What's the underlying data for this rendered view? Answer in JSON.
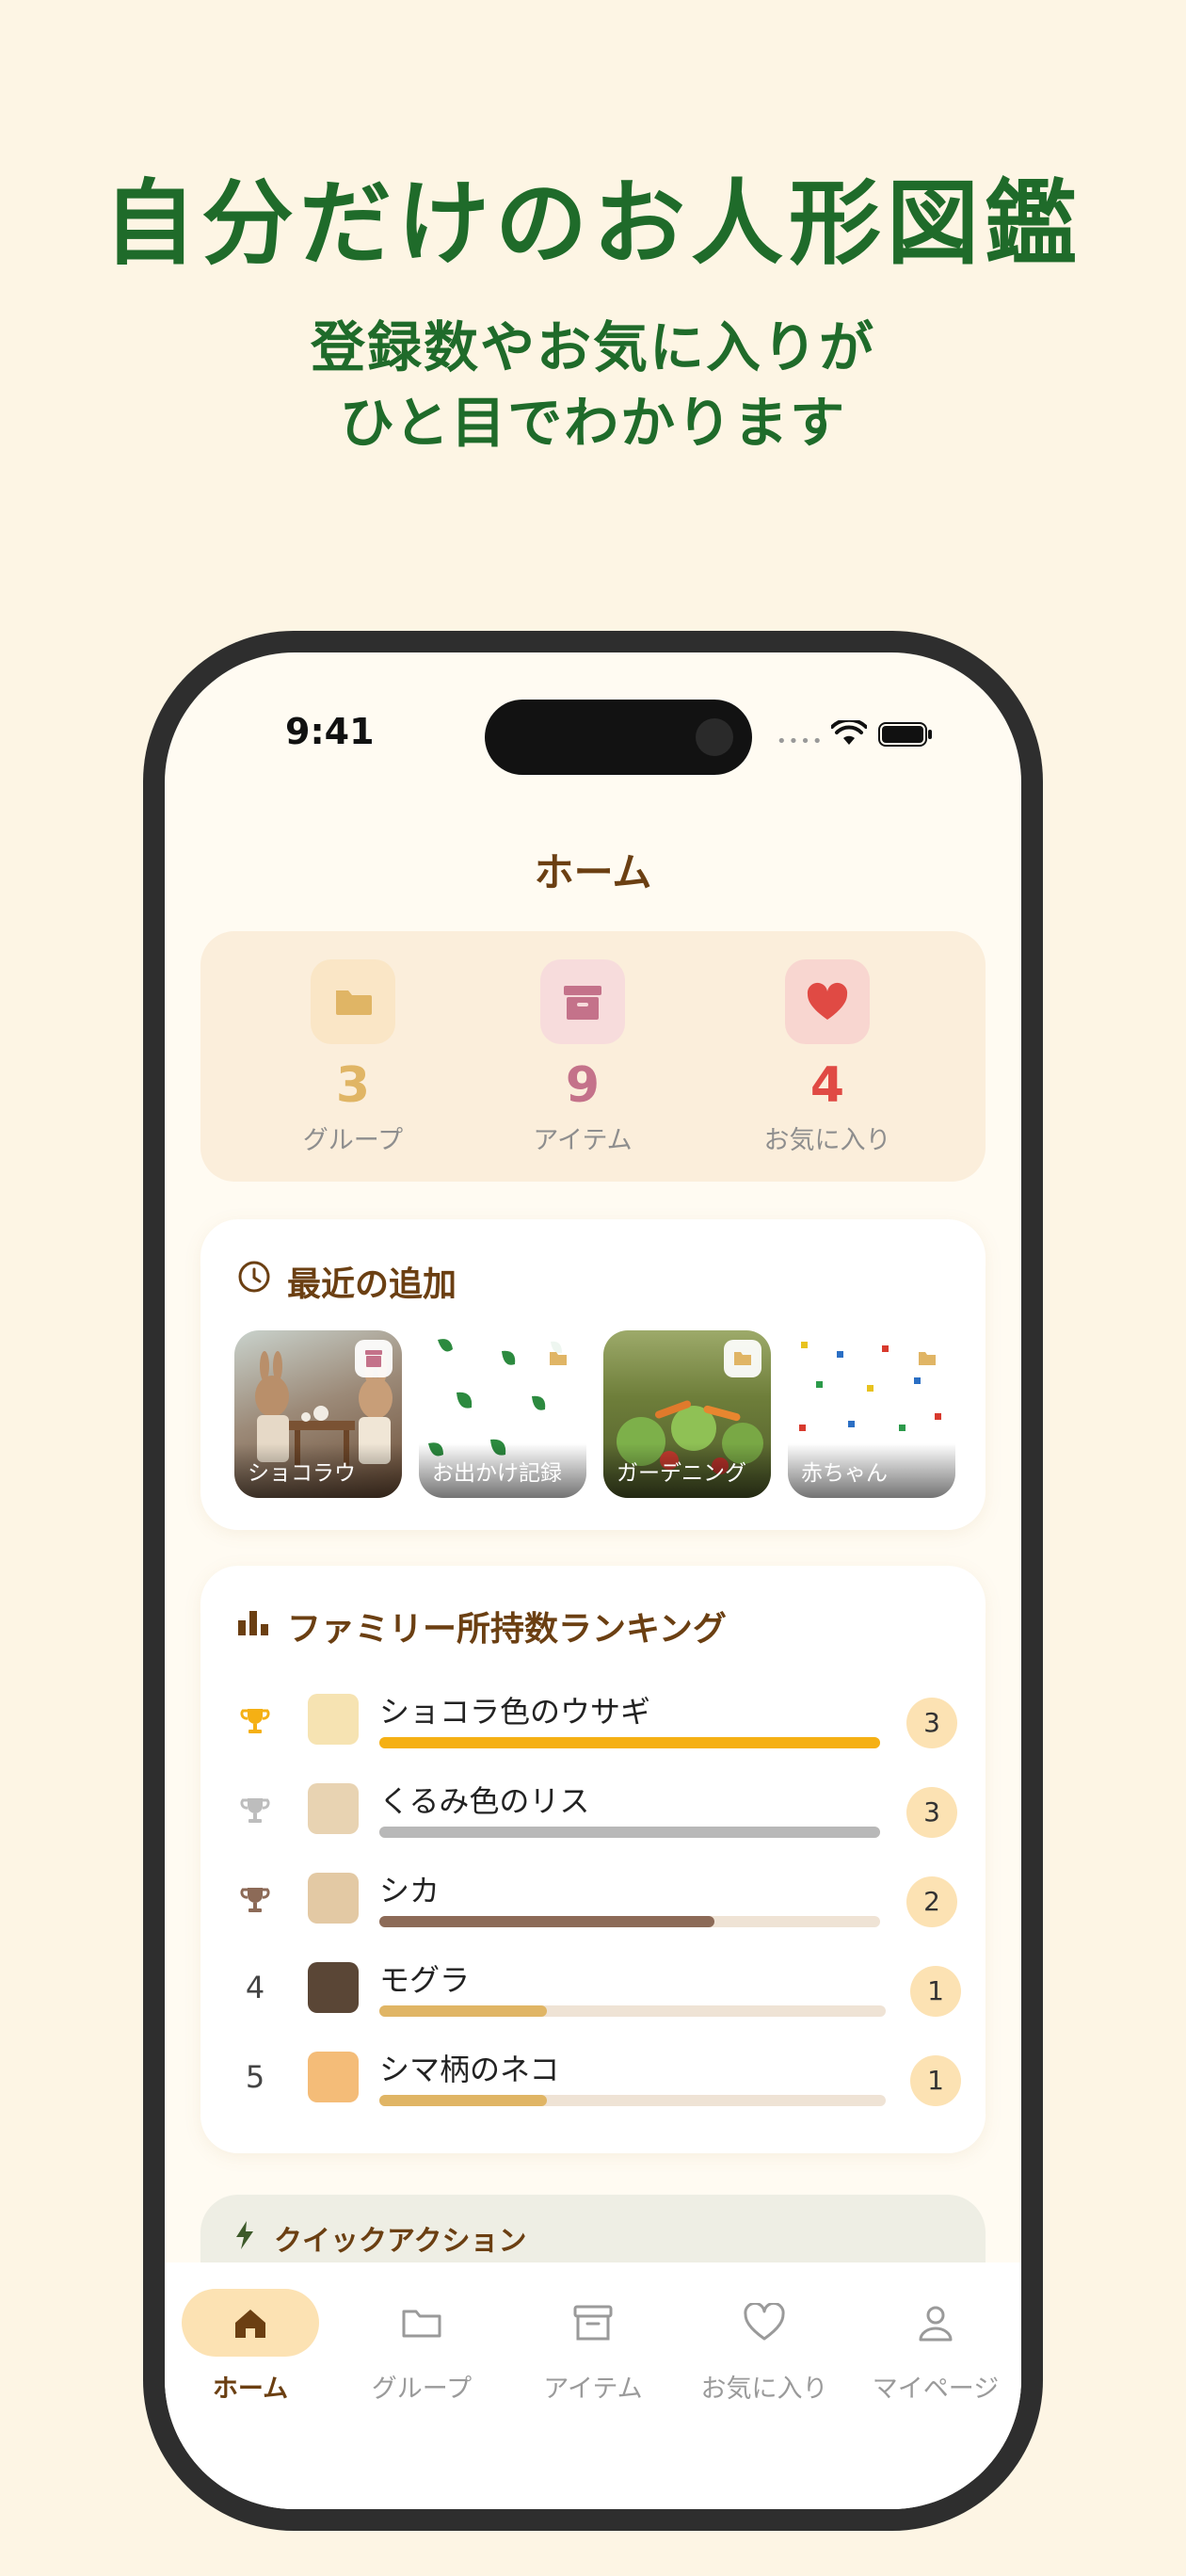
{
  "promo": {
    "headline": "自分だけのお人形図鑑",
    "subline1": "登録数やお気に入りが",
    "subline2": "ひと目でわかります"
  },
  "status_bar": {
    "time": "9:41"
  },
  "nav": {
    "title": "ホーム"
  },
  "stats": [
    {
      "value": "3",
      "label": "グループ",
      "icon": "folder-icon",
      "color": "#E0B565"
    },
    {
      "value": "9",
      "label": "アイテム",
      "icon": "archive-box-icon",
      "color": "#C4728A"
    },
    {
      "value": "4",
      "label": "お気に入り",
      "icon": "heart-icon",
      "color": "#E04A44"
    }
  ],
  "recent": {
    "title": "最近の追加",
    "items": [
      {
        "label": "ショコラウ",
        "type_icon": "archive-box-icon"
      },
      {
        "label": "お出かけ記録",
        "type_icon": "folder-icon"
      },
      {
        "label": "ガーデニング",
        "type_icon": "folder-icon"
      },
      {
        "label": "赤ちゃん",
        "type_icon": "folder-icon"
      }
    ]
  },
  "ranking": {
    "title": "ファミリー所持数ランキング",
    "rows": [
      {
        "rank": "1",
        "mark": "trophy-gold-icon",
        "name": "ショコラ色のウサギ",
        "count": "3",
        "share": 1.0,
        "bar_color": "#F5B014",
        "avatar": "rabbit-avatar"
      },
      {
        "rank": "2",
        "mark": "trophy-silver-icon",
        "name": "くるみ色のリス",
        "count": "3",
        "share": 1.0,
        "bar_color": "#B8B8B8",
        "avatar": "squirrel-avatar"
      },
      {
        "rank": "3",
        "mark": "trophy-bronze-icon",
        "name": "シカ",
        "count": "2",
        "share": 0.67,
        "bar_color": "#8C6A57",
        "avatar": "deer-avatar"
      },
      {
        "rank": "4",
        "mark": "",
        "name": "モグラ",
        "count": "1",
        "share": 0.33,
        "bar_color": "#E0B565",
        "avatar": "mole-avatar"
      },
      {
        "rank": "5",
        "mark": "",
        "name": "シマ柄のネコ",
        "count": "1",
        "share": 0.33,
        "bar_color": "#E0B565",
        "avatar": "cat-avatar"
      }
    ]
  },
  "quick_actions": {
    "title": "クイックアクション"
  },
  "tabs": [
    {
      "label": "ホーム",
      "icon": "home-icon",
      "active": true
    },
    {
      "label": "グループ",
      "icon": "folder-icon",
      "active": false
    },
    {
      "label": "アイテム",
      "icon": "archive-box-icon",
      "active": false
    },
    {
      "label": "お気に入り",
      "icon": "heart-icon",
      "active": false
    },
    {
      "label": "マイページ",
      "icon": "person-icon",
      "active": false
    }
  ]
}
